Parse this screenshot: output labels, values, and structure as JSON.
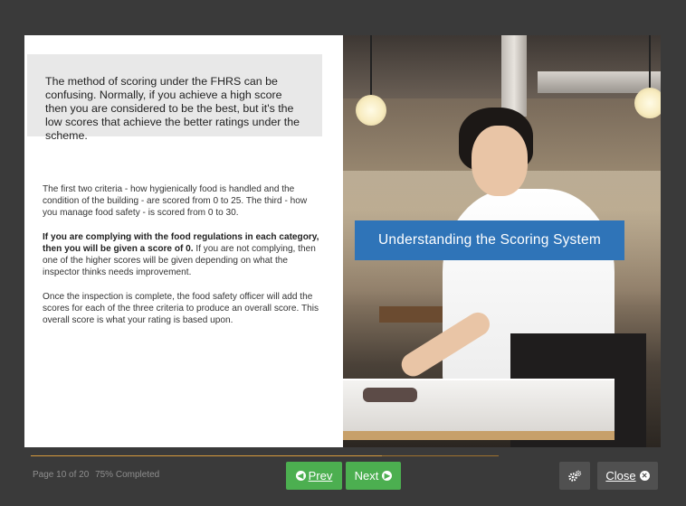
{
  "slide": {
    "intro_text": "The method of scoring under the FHRS can be confusing. Normally, if you achieve a high score then you are considered to be the best, but it's the low scores that achieve the better ratings under the scheme.",
    "paragraph_1": "The first two criteria - how hygienically food is handled and the condition of the building - are scored from 0 to 25. The third - how you manage food safety - is scored from 0 to 30.",
    "paragraph_2_bold": "If you are complying with the food regulations in each category, then you will be given a score of 0.",
    "paragraph_2_rest": " If you are not complying, then one of the higher scores will be given depending on what the inspector thinks needs improvement.",
    "paragraph_3": "Once the inspection is complete, the food safety officer will add the scores for each of the three criteria to produce an overall score. This overall score is what your rating is based upon.",
    "image_title": "Understanding the Scoring System"
  },
  "footer": {
    "page_label": "Page 10 of 20",
    "completed_label": "75% Completed",
    "progress_percent": 75,
    "prev_label": "Prev",
    "next_label": "Next",
    "close_label": "Close",
    "prev_icon": "chevron-left-circle-icon",
    "next_icon": "chevron-right-circle-icon",
    "settings_icon": "gears-icon",
    "close_icon": "x-circle-icon"
  },
  "colors": {
    "background": "#3a3a3a",
    "accent_green": "#4caf50",
    "banner_blue": "#2f74b8",
    "progress": "#d89a3c"
  }
}
